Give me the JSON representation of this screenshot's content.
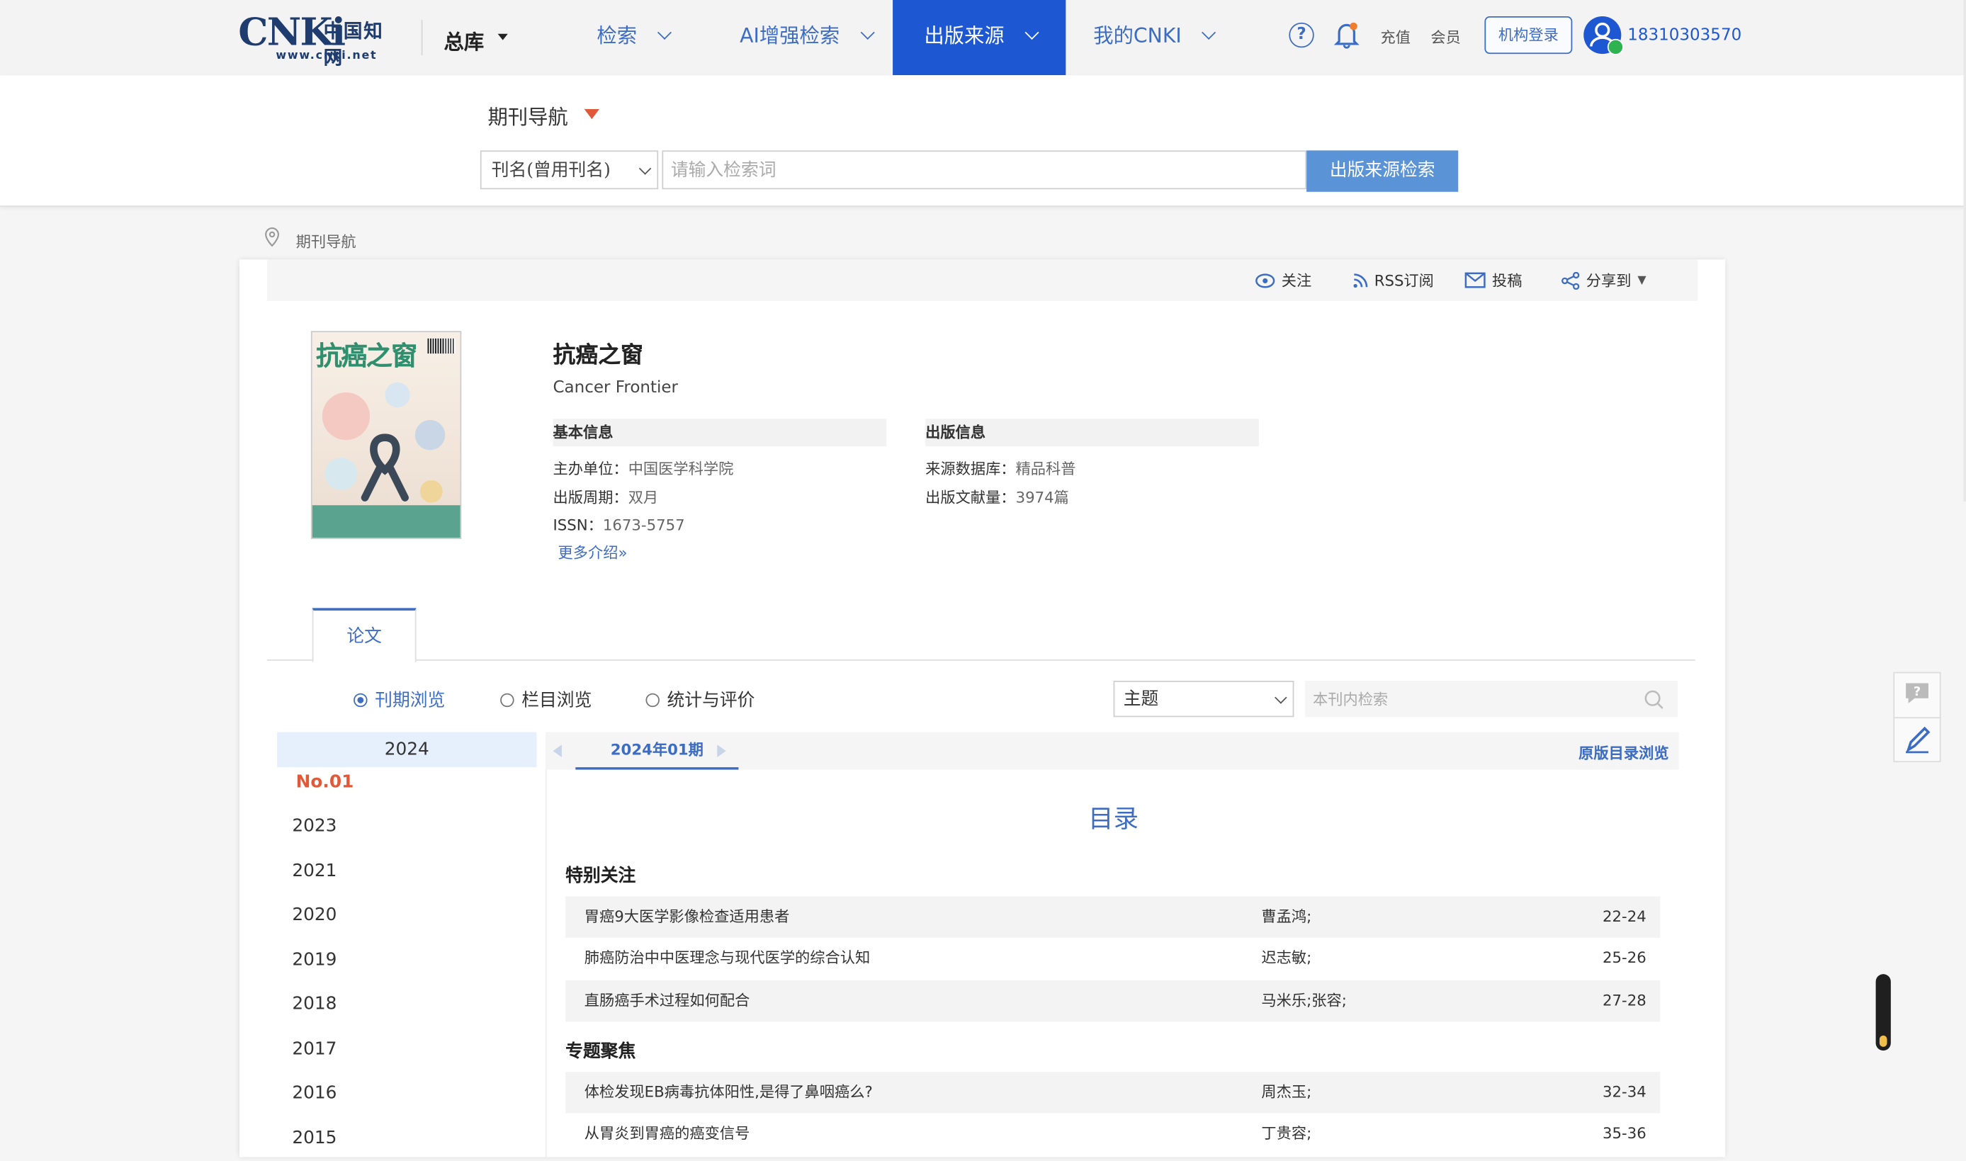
{
  "topbar": {
    "logo_brand": "CNKi",
    "logo_cn": "中国知网",
    "logo_url": "www.cnki.net",
    "library": "总库",
    "nav": [
      {
        "label": "检索",
        "active": false
      },
      {
        "label": "AI增强检索",
        "active": false
      },
      {
        "label": "出版来源",
        "active": true
      },
      {
        "label": "我的CNKI",
        "active": false
      }
    ],
    "help_glyph": "?",
    "recharge": "充值",
    "member": "会员",
    "org_login": "机构登录",
    "username": "18310303570"
  },
  "search": {
    "nav_label": "期刊导航",
    "field_select": "刊名(曾用刊名)",
    "placeholder": "请输入检索词",
    "button": "出版来源检索"
  },
  "breadcrumb": "期刊导航",
  "actions": {
    "follow": "关注",
    "rss": "RSS订阅",
    "submit": "投稿",
    "share": "分享到"
  },
  "journal": {
    "cover_title": "抗癌之窗",
    "name": "抗癌之窗",
    "english_name": "Cancer Frontier",
    "basic_header": "基本信息",
    "publish_header": "出版信息",
    "sponsor_label": "主办单位：",
    "sponsor": "中国医学科学院",
    "cycle_label": "出版周期：",
    "cycle": "双月",
    "issn_label": "ISSN：",
    "issn": "1673-5757",
    "db_label": "来源数据库：",
    "db": "精品科普",
    "count_label": "出版文献量：",
    "count": "3974篇",
    "more": "更多介绍"
  },
  "tabs": {
    "paper": "论文"
  },
  "browse": {
    "modes": [
      "刊期浏览",
      "栏目浏览",
      "统计与评价"
    ],
    "active_mode": 0,
    "field": "主题",
    "inner_placeholder": "本刊内检索"
  },
  "years": {
    "open_year": "2024",
    "open_issue": "No.01",
    "others": [
      "2023",
      "2021",
      "2020",
      "2019",
      "2018",
      "2017",
      "2016",
      "2015"
    ]
  },
  "issue": {
    "current": "2024年01期",
    "original_toc": "原版目录浏览",
    "toc_title": "目录",
    "sections": [
      {
        "name": "特别关注",
        "articles": [
          {
            "title": "胃癌9大医学影像检查适用患者",
            "author": "曹孟鸿;",
            "pages": "22-24"
          },
          {
            "title": "肺癌防治中中医理念与现代医学的综合认知",
            "author": "迟志敏;",
            "pages": "25-26"
          },
          {
            "title": "直肠癌手术过程如何配合",
            "author": "马米乐;张容;",
            "pages": "27-28"
          }
        ]
      },
      {
        "name": "专题聚焦",
        "articles": [
          {
            "title": "体检发现EB病毒抗体阳性,是得了鼻咽癌么?",
            "author": "周杰玉;",
            "pages": "32-34"
          },
          {
            "title": "从胃炎到胃癌的癌变信号",
            "author": "丁贵容;",
            "pages": "35-36"
          }
        ]
      }
    ]
  },
  "colors": {
    "brand_blue": "#1d57d1",
    "link_blue": "#3d6dc3",
    "accent_red": "#e05a3a",
    "button_blue": "#5b93d7"
  }
}
